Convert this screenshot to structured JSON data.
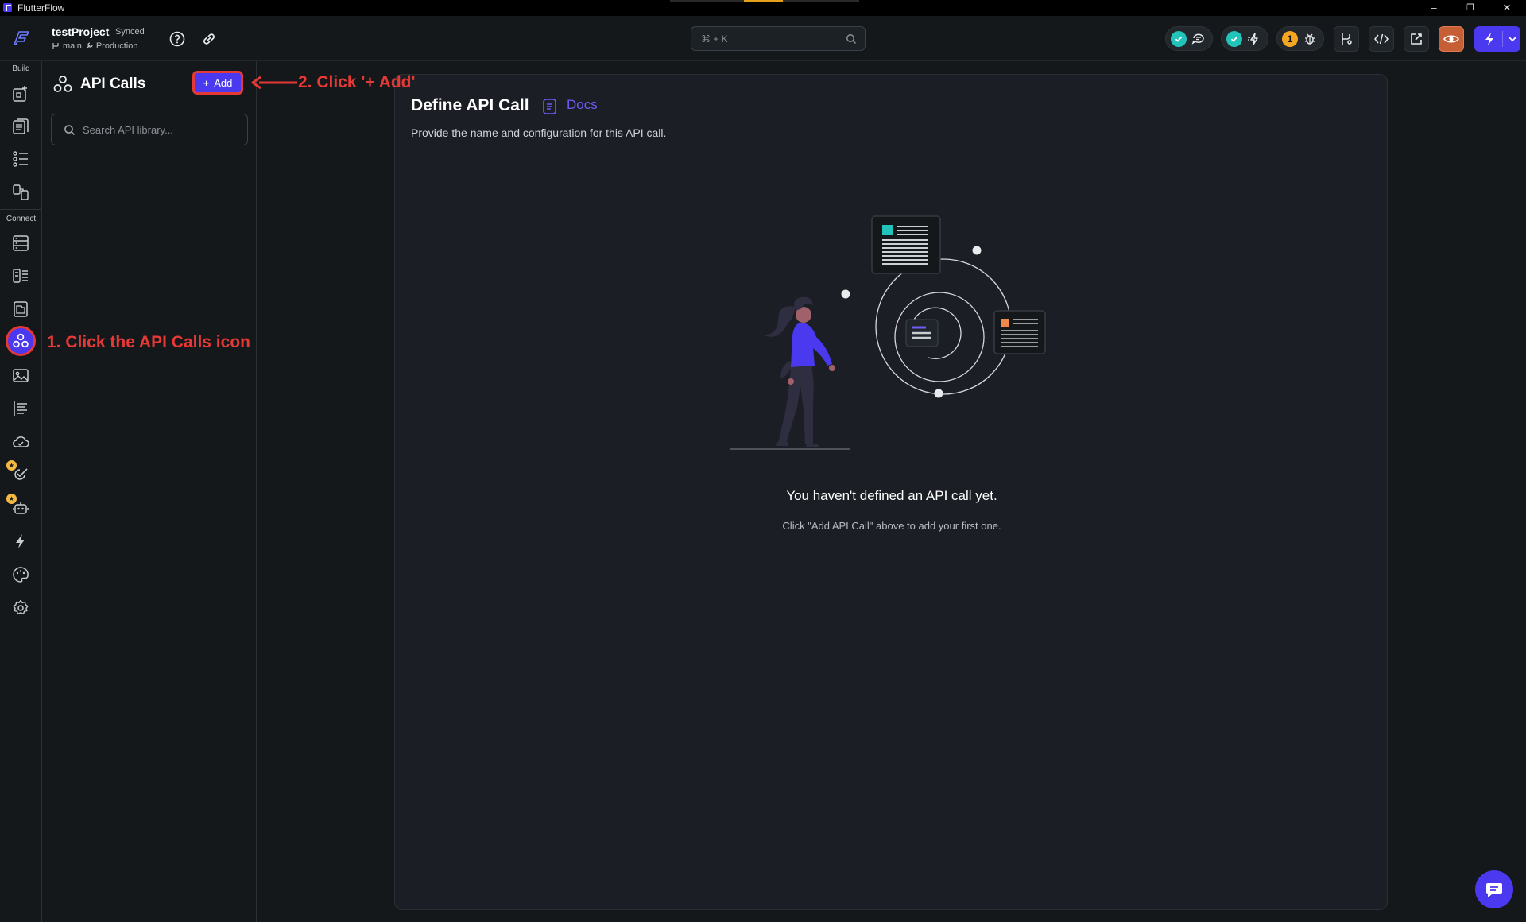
{
  "window": {
    "app_name": "FlutterFlow",
    "minimize": "–",
    "restore": "❐",
    "close": "✕"
  },
  "header": {
    "project_name": "testProject",
    "sync_status": "Synced",
    "branch": "main",
    "environment": "Production",
    "search_shortcut": "⌘ + K",
    "warning_count": "1"
  },
  "rail": {
    "build_label": "Build",
    "connect_label": "Connect"
  },
  "panel": {
    "title": "API Calls",
    "add_label": "Add",
    "search_placeholder": "Search API library..."
  },
  "main": {
    "title": "Define API Call",
    "docs_label": "Docs",
    "subtitle": "Provide the name and configuration for this API call.",
    "empty_title": "You haven't defined an API call yet.",
    "empty_subtitle": "Click \"Add API Call\" above to add your first one."
  },
  "annotations": {
    "step1": "1. Click the API Calls icon",
    "step2": "2. Click '+ Add'"
  },
  "colors": {
    "accent": "#4b39ef",
    "annotation": "#e53935",
    "success": "#22c3b8",
    "warning": "#f5a623"
  }
}
